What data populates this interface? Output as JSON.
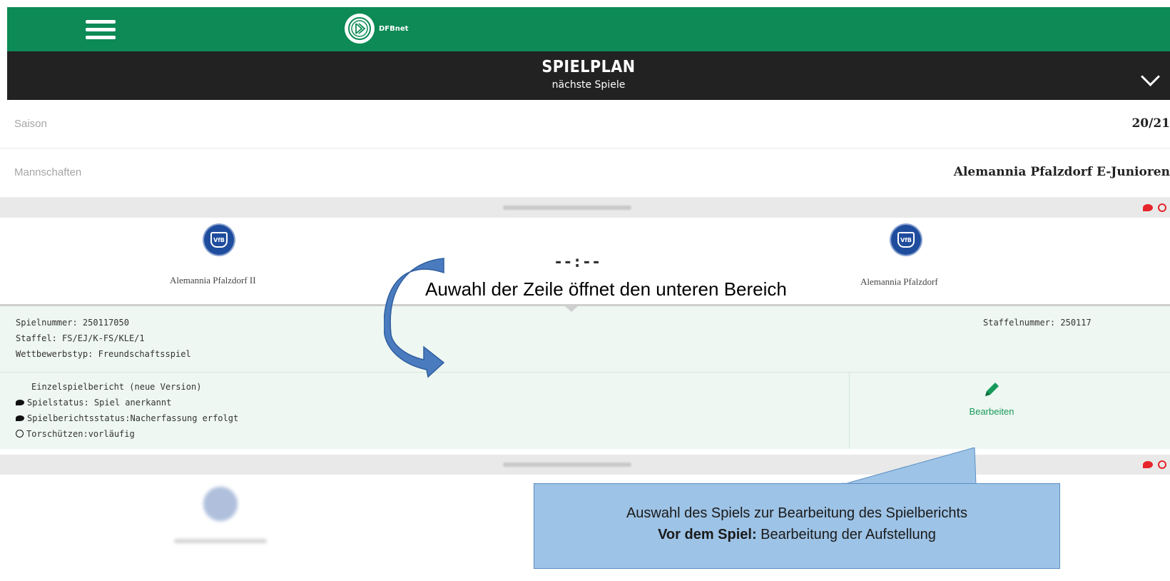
{
  "header": {
    "logo_text": "DFBnet",
    "title": "SPIELPLAN",
    "subtitle": "nächste Spiele",
    "brand_color": "#0d8a55"
  },
  "filters": {
    "season_label": "Saison",
    "season_value": "20/21",
    "teams_label": "Mannschaften",
    "teams_value": "Alemannia Pfalzdorf E-Junioren"
  },
  "match": {
    "home_team": "Alemannia Pfalzdorf II",
    "away_team": "Alemannia Pfalzdorf",
    "score": "--:--",
    "crest_text": "VfB",
    "game_number": "Spielnummer: 250117050",
    "league": "Staffel: FS/EJ/K-FS/KLE/1",
    "competition_type": "Wettbewerbstyp: Freundschaftsspiel",
    "league_number": "Staffelnummer: 250117",
    "report_version": "Einzelspielbericht (neue Version)",
    "game_status": "Spielstatus: Spiel anerkannt",
    "report_status": "Spielberichtsstatus:Nacherfassung erfolgt",
    "scorers": "Torschützen:vorläufig",
    "edit_label": "Bearbeiten"
  },
  "annotations": {
    "row_hint": "Auwahl der Zeile öffnet den unteren Bereich",
    "callout_line1": "Auswahl des Spiels zur Bearbeitung des Spielberichts",
    "callout_line2_bold": "Vor dem Spiel:",
    "callout_line2_rest": " Bearbeitung der Aufstellung"
  }
}
